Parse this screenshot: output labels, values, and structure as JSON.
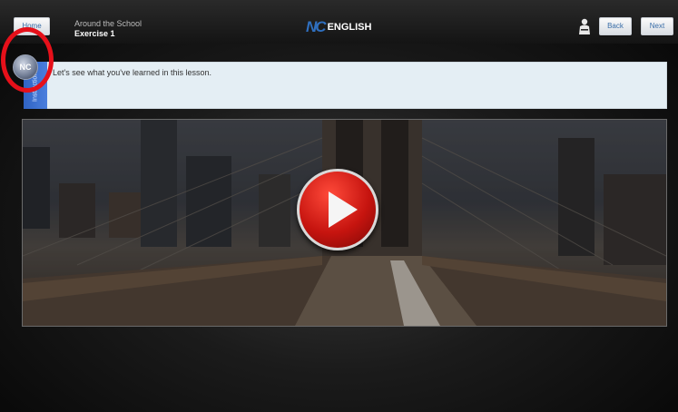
{
  "header": {
    "home_label": "Home",
    "lesson_title": "Around the School",
    "exercise_title": "Exercise 1",
    "logo_mark": "NC",
    "logo_word": "ENGLISH",
    "back_label": "Back",
    "next_label": "Next"
  },
  "instructions": {
    "tab_label": "Instructions",
    "badge_text": "NC",
    "text": "Let's see what you've learned in this lesson."
  },
  "icons": {
    "user": "user-icon",
    "play": "play-icon",
    "badge": "nc-badge-icon"
  },
  "colors": {
    "accent_blue": "#2f63c4",
    "play_red": "#c6140f",
    "highlight_red": "#e6101a"
  }
}
